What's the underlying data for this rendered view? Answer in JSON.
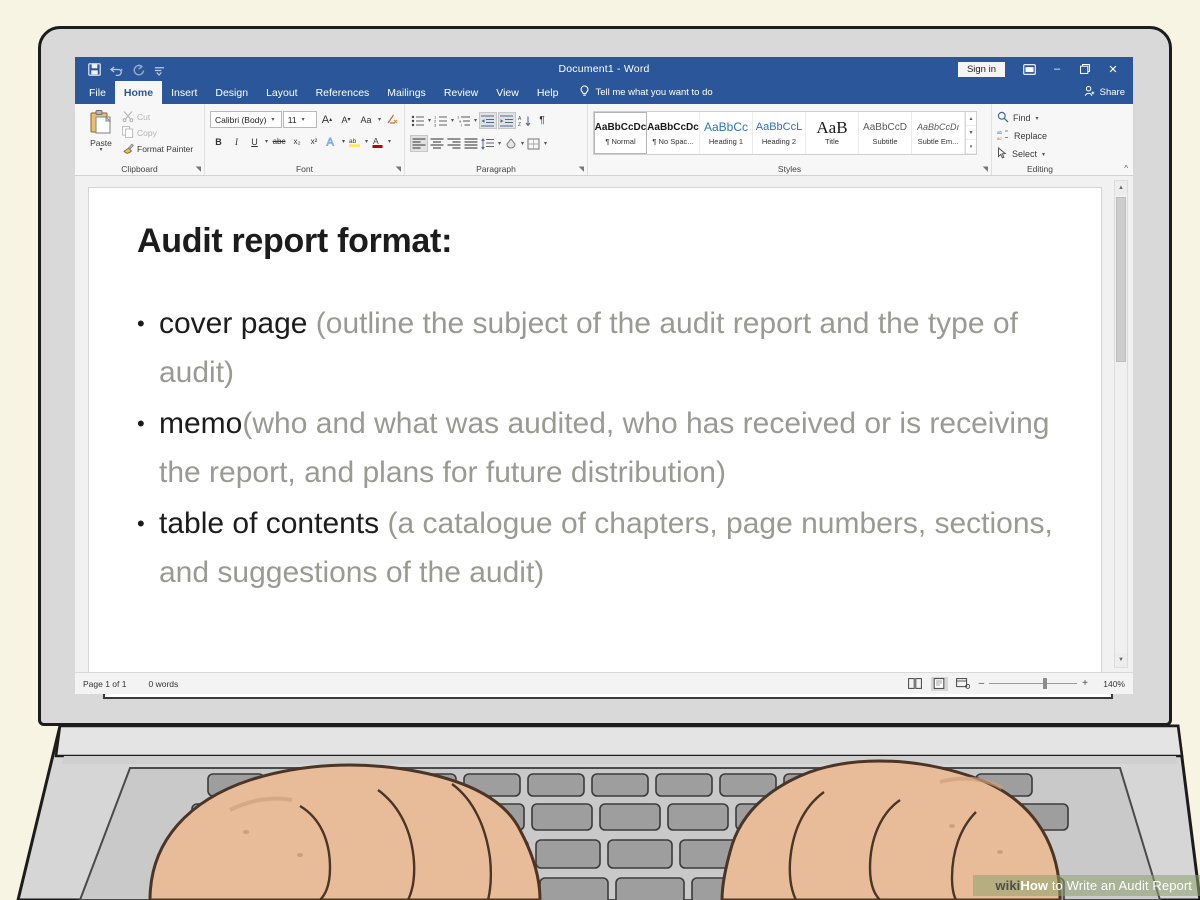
{
  "window": {
    "title": "Document1  -  Word",
    "quick_access": [
      "save-icon",
      "undo-icon",
      "redo-icon",
      "customize-qat-icon"
    ],
    "sign_in": "Sign in",
    "ribbon_display_icon": "ribbon-display-options-icon",
    "minimize": "–",
    "restore": "❐",
    "close": "✕"
  },
  "tabs": [
    {
      "label": "File",
      "active": false
    },
    {
      "label": "Home",
      "active": true
    },
    {
      "label": "Insert",
      "active": false
    },
    {
      "label": "Design",
      "active": false
    },
    {
      "label": "Layout",
      "active": false
    },
    {
      "label": "References",
      "active": false
    },
    {
      "label": "Mailings",
      "active": false
    },
    {
      "label": "Review",
      "active": false
    },
    {
      "label": "View",
      "active": false
    },
    {
      "label": "Help",
      "active": false
    }
  ],
  "tell_me": "Tell me what you want to do",
  "share": "Share",
  "ribbon": {
    "clipboard": {
      "group_label": "Clipboard",
      "paste": "Paste",
      "cut": "Cut",
      "copy": "Copy",
      "format_painter": "Format Painter"
    },
    "font": {
      "group_label": "Font",
      "font_name": "Calibri (Body)",
      "font_size": "11",
      "grow_font": "A",
      "shrink_font": "A",
      "change_case": "Aa",
      "clear_formatting": "clear-formatting-icon",
      "bold": "B",
      "italic": "I",
      "underline": "U",
      "strikethrough": "abc",
      "subscript": "x₂",
      "superscript": "x²",
      "text_effects": "A",
      "highlight": "ab",
      "font_color": "A"
    },
    "paragraph": {
      "group_label": "Paragraph",
      "bullets": "bullets-icon",
      "numbering": "numbering-icon",
      "multilevel_list": "multilevel-list-icon",
      "decrease_indent": "decrease-indent-icon",
      "increase_indent": "increase-indent-icon",
      "sort": "sort-icon",
      "show_marks": "¶",
      "align_left": "align-left-icon",
      "align_center": "align-center-icon",
      "align_right": "align-right-icon",
      "justify": "justify-icon",
      "line_spacing": "line-spacing-icon",
      "shading": "shading-icon",
      "borders": "borders-icon"
    },
    "styles": {
      "group_label": "Styles",
      "items": [
        {
          "preview": "AaBbCcDc",
          "name": "¶ Normal",
          "selected": true,
          "style": "plain"
        },
        {
          "preview": "AaBbCcDc",
          "name": "¶ No Spac...",
          "selected": false,
          "style": "plain"
        },
        {
          "preview": "AaBbCc",
          "name": "Heading 1",
          "selected": false,
          "style": "blue"
        },
        {
          "preview": "AaBbCcL",
          "name": "Heading 2",
          "selected": false,
          "style": "blue"
        },
        {
          "preview": "AaB",
          "name": "Title",
          "selected": false,
          "style": "big"
        },
        {
          "preview": "AaBbCcD",
          "name": "Subtitle",
          "selected": false,
          "style": "plain"
        },
        {
          "preview": "AaBbCcDı",
          "name": "Subtle Em...",
          "selected": false,
          "style": "ital"
        }
      ]
    },
    "editing": {
      "group_label": "Editing",
      "find": "Find",
      "replace": "Replace",
      "select": "Select"
    },
    "collapse_ribbon": "^"
  },
  "document": {
    "heading": "Audit report format:",
    "bullets": [
      {
        "term": "cover page ",
        "description": "(outline the subject of the audit report and the type of audit)"
      },
      {
        "term": "memo",
        "description": "(who and what was audited, who has received or is receiving the report, and plans for future distribution)"
      },
      {
        "term": "table of contents ",
        "description": "(a catalogue of chapters, page numbers, sections, and suggestions of the audit)"
      }
    ]
  },
  "status_bar": {
    "page": "Page 1 of 1",
    "words": "0 words",
    "view_read": "read-mode-icon",
    "view_print": "print-layout-icon",
    "view_web": "web-layout-icon",
    "zoom_out": "–",
    "zoom_in": "+",
    "zoom_level": "140%"
  },
  "watermark": {
    "wiki": "wiki",
    "how": "How",
    "rest": " to Write an Audit Report"
  },
  "colors": {
    "word_blue": "#2b579a",
    "background": "#f7f4e3",
    "laptop_body": "#d9d9d9",
    "skin": "#e8bc98",
    "key_gray": "#9e9e9e"
  }
}
